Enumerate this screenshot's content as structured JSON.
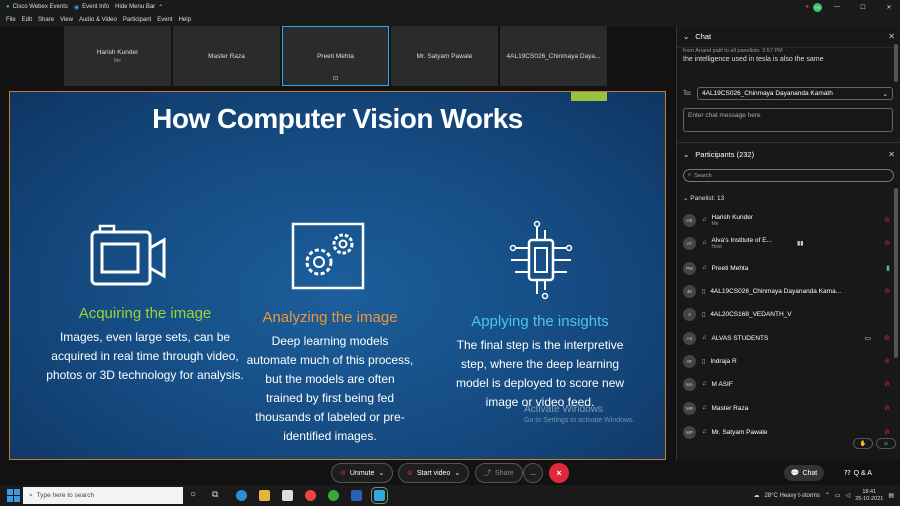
{
  "titlebar": {
    "app": "Cisco Webex Events",
    "event_info": "Event Info",
    "hide_menu": "Hide Menu Bar",
    "avatar_initial": "HK"
  },
  "menubar": [
    "File",
    "Edit",
    "Share",
    "View",
    "Audio & Video",
    "Participant",
    "Event",
    "Help"
  ],
  "thumbnails": [
    {
      "name": "Harish Kunder",
      "sub": "Me"
    },
    {
      "name": "Master Raza",
      "sub": ""
    },
    {
      "name": "Preeti Mehta",
      "sub": ""
    },
    {
      "name": "Mr. Satyam Pawale",
      "sub": ""
    },
    {
      "name": "4AL19CS026_Chinmaya Daya...",
      "sub": ""
    }
  ],
  "slide": {
    "title": "How Computer Vision Works",
    "columns": [
      {
        "heading": "Acquiring the image",
        "heading_color": "#9bd33a",
        "text": "Images, even large sets, can be acquired in real time through video, photos or 3D technology for analysis."
      },
      {
        "heading": "Analyzing the image",
        "heading_color": "#f0963a",
        "text": "Deep learning models automate much of this process, but the models are often trained by first being fed thousands of labeled or pre-identified images."
      },
      {
        "heading": "Applying the insights",
        "heading_color": "#4cc3f0",
        "text": "The final step is the interpretive step, where the deep learning model is deployed to score new image or video feed."
      }
    ],
    "watermark": "Activate Windows",
    "watermark_sub": "Go to Settings to activate Windows."
  },
  "controls": {
    "unmute": "Unmute",
    "start_video": "Start video",
    "share": "Share",
    "more": "...",
    "end": "×"
  },
  "chat": {
    "title": "Chat",
    "from_line": "from Anand patil to all panelists:   3:57 PM",
    "message": "the intelligence used in tesla is also the same",
    "to_label": "To:",
    "to_value": "4AL19CS026_Chinmaya Dayananda Kamath",
    "input_placeholder": "Enter chat message here"
  },
  "participants": {
    "title": "Participants (232)",
    "search_placeholder": "Search",
    "panelist_header": "Panelist: 13",
    "list": [
      {
        "initials": "HK",
        "name": "Harish Kunder",
        "sub": "Me",
        "mic": "muted"
      },
      {
        "initials": "AT",
        "name": "Alva's Institute of E...",
        "sub": "Host",
        "mic": "muted"
      },
      {
        "initials": "PM",
        "name": "Preeti Mehta",
        "sub": "",
        "mic": "on"
      },
      {
        "initials": "4K",
        "name": "4AL19CS026_Chinmaya Dayananda Kama...",
        "sub": "",
        "mic": "muted"
      },
      {
        "initials": "4",
        "name": "4AL20CS168_VEDANTH_V",
        "sub": "",
        "mic": ""
      },
      {
        "initials": "AS",
        "name": "ALVAS STUDENTS",
        "sub": "",
        "mic": "video"
      },
      {
        "initials": "IR",
        "name": "Indraja R",
        "sub": "",
        "mic": "muted"
      },
      {
        "initials": "MA",
        "name": "M ASIF",
        "sub": "",
        "mic": "muted"
      },
      {
        "initials": "MR",
        "name": "Master Raza",
        "sub": "",
        "mic": "muted"
      },
      {
        "initials": "MP",
        "name": "Mr. Satyam Pawale",
        "sub": "",
        "mic": "muted"
      }
    ]
  },
  "bottom_tabs": {
    "chat": "Chat",
    "qa": "Q & A"
  },
  "taskbar": {
    "search": "Type here to search",
    "weather": "28°C  Heavy t-storms",
    "time": "18:41",
    "date": "25-10-2021"
  }
}
